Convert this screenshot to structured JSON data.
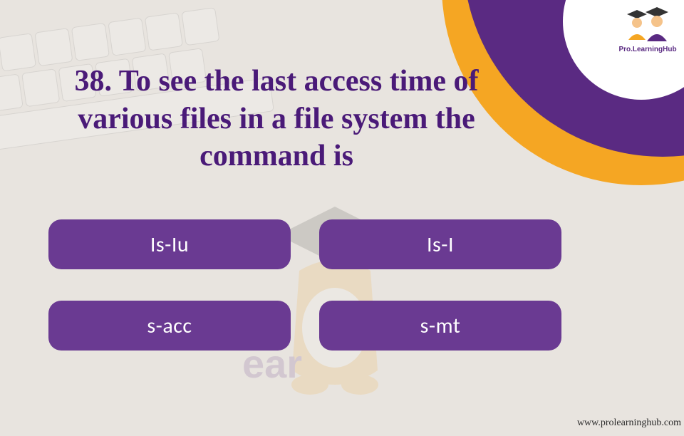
{
  "brand": {
    "name": "Pro.LearningHub"
  },
  "question": {
    "number": "38.",
    "text": "To see the last access time of various files in a file system the command is"
  },
  "options": [
    {
      "label": "Is-Iu"
    },
    {
      "label": "Is-I"
    },
    {
      "label": "s-acc"
    },
    {
      "label": "s-mt"
    }
  ],
  "footer": {
    "url": "www.prolearninghub.com"
  }
}
